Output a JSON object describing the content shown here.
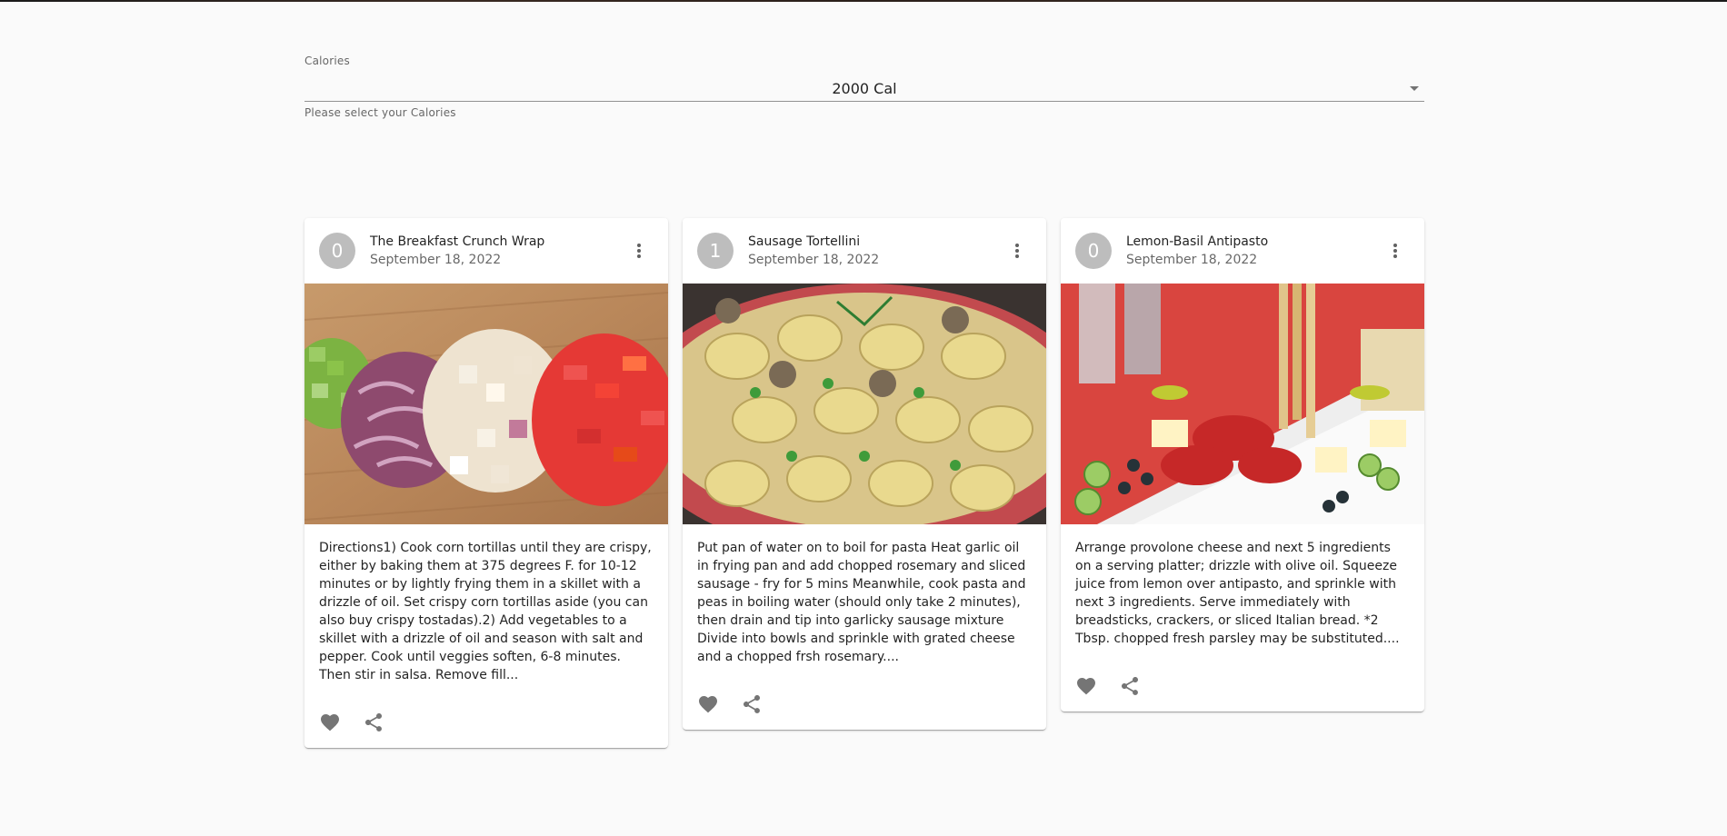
{
  "calories": {
    "label": "Calories",
    "value": "2000 Cal",
    "helper": "Please select your Calories"
  },
  "cards": [
    {
      "avatar": "0",
      "title": "The Breakfast Crunch Wrap",
      "date": "September 18, 2022",
      "description": "Directions1) Cook corn tortillas until they are crispy, either by baking them at 375 degrees F. for 10-12 minutes or by lightly frying them in a skillet with a drizzle of oil. Set crispy corn tortillas aside (you can also buy crispy tostadas).2) Add vegetables to a skillet with a drizzle of oil and season with salt and pepper. Cook until veggies soften, 6-8 minutes. Then stir in salsa. Remove fill..."
    },
    {
      "avatar": "1",
      "title": "Sausage Tortellini",
      "date": "September 18, 2022",
      "description": "Put pan of water on to boil for pasta Heat garlic oil in frying pan and add chopped rosemary and sliced sausage - fry for 5 mins Meanwhile, cook pasta and peas in boiling water (should only take 2 minutes), then drain and tip into garlicky sausage mixture Divide into bowls and sprinkle with grated cheese and a chopped frsh rosemary...."
    },
    {
      "avatar": "0",
      "title": "Lemon-Basil Antipasto",
      "date": "September 18, 2022",
      "description": "Arrange provolone cheese and next 5 ingredients on a serving platter; drizzle with olive oil. Squeeze juice from lemon over antipasto, and sprinkle with next 3 ingredients. Serve immediately with breadsticks, crackers, or sliced Italian bread. *2 Tbsp. chopped fresh parsley may be substituted...."
    }
  ],
  "icons": {
    "more": "more-vert-icon",
    "favorite": "heart-icon",
    "share": "share-icon"
  },
  "colors": {
    "avatar": "#bdbdbd",
    "icon": "#757575"
  }
}
